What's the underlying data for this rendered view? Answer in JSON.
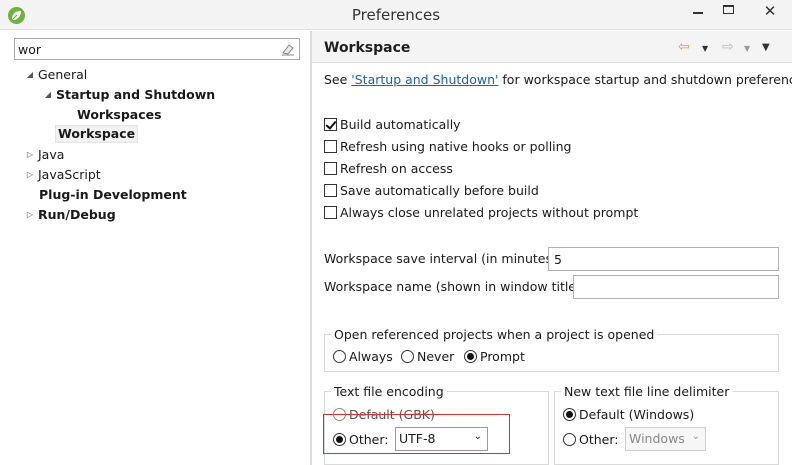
{
  "window": {
    "title": "Preferences",
    "close_glyph": "✕",
    "icons": {
      "app": "spring-leaf-icon",
      "minimize": "minimize-icon",
      "maximize": "maximize-icon",
      "close": "close-icon"
    }
  },
  "filter": {
    "value": "wor",
    "clear_icon": "eraser-icon"
  },
  "tree": {
    "items": [
      {
        "label": "General",
        "expanded": true,
        "level": 0,
        "bold": false
      },
      {
        "label": "Startup and Shutdown",
        "expanded": true,
        "level": 1,
        "bold": true
      },
      {
        "label": "Workspaces",
        "level": 2,
        "bold": true
      },
      {
        "label": "Workspace",
        "level": 1,
        "bold": true,
        "selected": true
      },
      {
        "label": "Java",
        "expanded": false,
        "level": 0,
        "bold": false
      },
      {
        "label": "JavaScript",
        "expanded": false,
        "level": 0,
        "bold": false
      },
      {
        "label": "Plug-in Development",
        "level": 0,
        "bold": true
      },
      {
        "label": "Run/Debug",
        "expanded": false,
        "level": 0,
        "bold": true
      }
    ]
  },
  "page": {
    "title": "Workspace",
    "nav_icons": [
      "back-arrow-icon",
      "back-history-dropdown-icon",
      "forward-arrow-icon",
      "forward-history-dropdown-icon",
      "view-menu-icon"
    ],
    "see_prefix": "See ",
    "see_link": "'Startup and Shutdown'",
    "see_suffix": " for workspace startup and shutdown preferences.",
    "checkboxes": [
      {
        "label": "Build automatically",
        "checked": true
      },
      {
        "label": "Refresh using native hooks or polling",
        "checked": false
      },
      {
        "label": "Refresh on access",
        "checked": false
      },
      {
        "label": "Save automatically before build",
        "checked": false
      },
      {
        "label": "Always close unrelated projects without prompt",
        "checked": false
      }
    ],
    "save_interval": {
      "label": "Workspace save interval (in minutes):",
      "value": "5"
    },
    "workspace_name": {
      "label": "Workspace name (shown in window title):",
      "value": ""
    },
    "open_referenced": {
      "title": "Open referenced projects when a project is opened",
      "options": [
        "Always",
        "Never",
        "Prompt"
      ],
      "selected": "Prompt"
    },
    "encoding": {
      "title": "Text file encoding",
      "default_label": "Default (GBK)",
      "other_label": "Other:",
      "other_value": "UTF-8",
      "selected": "Other"
    },
    "line_delimiter": {
      "title": "New text file line delimiter",
      "default_label": "Default (Windows)",
      "other_label": "Other:",
      "other_value": "Windows",
      "selected": "Default"
    }
  },
  "colors": {
    "highlight_box": "#d0312d",
    "link": "#1a5fb4",
    "spring_green": "#6db33f"
  }
}
